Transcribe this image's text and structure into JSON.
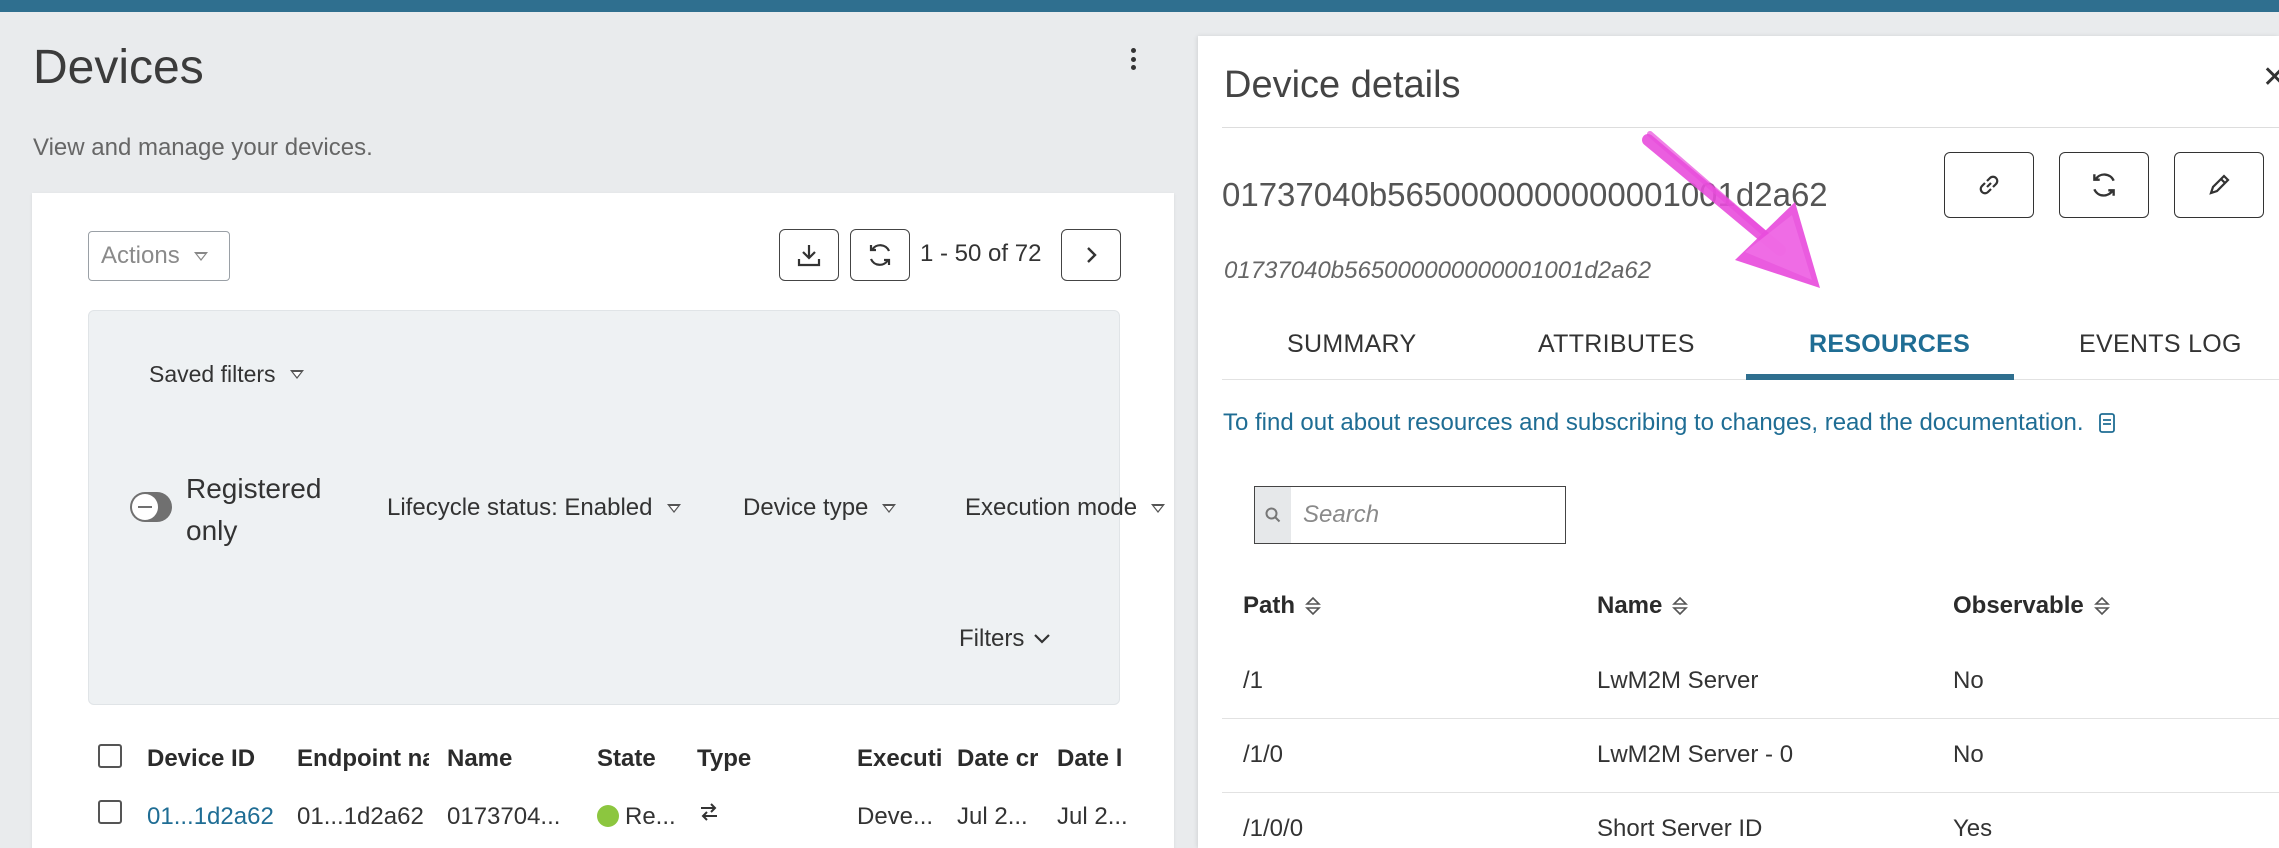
{
  "page": {
    "title": "Devices",
    "subtitle": "View and manage your devices."
  },
  "toolbar": {
    "actions_label": "Actions",
    "paging": "1 - 50 of 72"
  },
  "filters": {
    "saved_filters": "Saved filters",
    "registered_only": "Registered only",
    "lifecycle": "Lifecycle status: Enabled",
    "device_type": "Device type",
    "execution_mode": "Execution mode",
    "filters_link": "Filters"
  },
  "table": {
    "columns": [
      "Device ID",
      "Endpoint na",
      "Name",
      "State",
      "Type",
      "Executi",
      "Date cr",
      "Date l"
    ],
    "row": {
      "device_id": "01...1d2a62",
      "endpoint": "01...1d2a62",
      "name": "0173704...",
      "state": "Re...",
      "execution": "Deve...",
      "date_created": "Jul 2...",
      "date_last": "Jul 2..."
    }
  },
  "details": {
    "title": "Device details",
    "device_id": "01737040b5650000000000001001d2a62",
    "device_id_sub": "01737040b565000000000001001d2a62",
    "tabs": [
      "SUMMARY",
      "ATTRIBUTES",
      "RESOURCES",
      "EVENTS LOG"
    ],
    "active_tab": "RESOURCES",
    "doc_text": "To find out about resources and subscribing to changes, read the documentation.",
    "search_placeholder": "Search",
    "columns": [
      "Path",
      "Name",
      "Observable"
    ],
    "rows": [
      {
        "path": "/1",
        "name": "LwM2M Server",
        "observable": "No"
      },
      {
        "path": "/1/0",
        "name": "LwM2M Server - 0",
        "observable": "No"
      },
      {
        "path": "/1/0/0",
        "name": "Short Server ID",
        "observable": "Yes"
      }
    ]
  },
  "colors": {
    "accent": "#1f6d94",
    "topbar": "#2f6f8f",
    "state_ok": "#8cc63f",
    "annotation": "#e84ddc"
  }
}
